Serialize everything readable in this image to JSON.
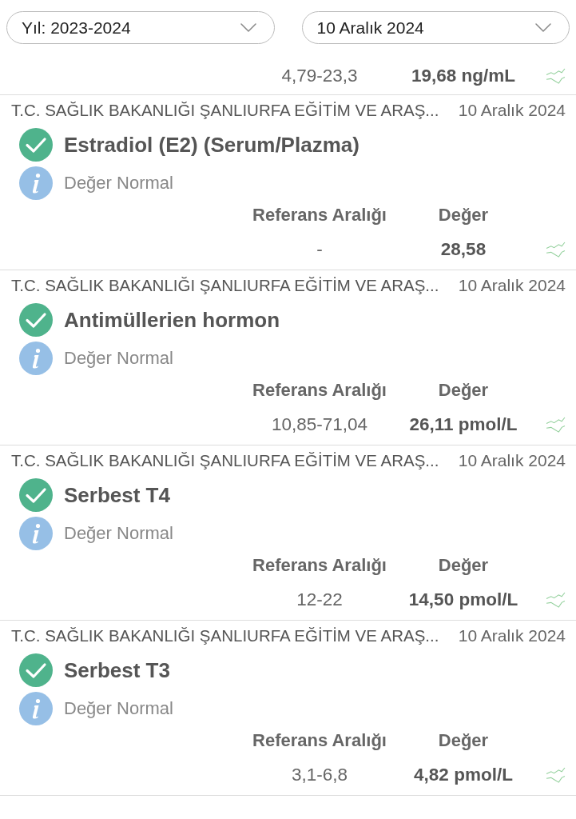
{
  "year_filter": {
    "value": "Yıl: 2023-2024"
  },
  "date_filter": {
    "value": "10 Aralık 2024"
  },
  "partial_result": {
    "reference": "4,79-23,3",
    "value": "19,68 ng/mL"
  },
  "results": [
    {
      "institution": "T.C. SAĞLIK BAKANLIĞI ŞANLIURFA EĞİTİM VE ARAŞ...",
      "date": "10 Aralık 2024",
      "test": "Estradiol (E2) (Serum/Plazma)",
      "status_text": "Değer Normal",
      "reference_label": "Referans Aralığı",
      "value_label": "Değer",
      "reference": "-",
      "value": "28,58"
    },
    {
      "institution": "T.C. SAĞLIK BAKANLIĞI ŞANLIURFA EĞİTİM VE ARAŞ...",
      "date": "10 Aralık 2024",
      "test": "Antimüllerien hormon",
      "status_text": "Değer Normal",
      "reference_label": "Referans Aralığı",
      "value_label": "Değer",
      "reference": "10,85-71,04",
      "value": "26,11 pmol/L"
    },
    {
      "institution": "T.C. SAĞLIK BAKANLIĞI ŞANLIURFA EĞİTİM VE ARAŞ...",
      "date": "10 Aralık 2024",
      "test": "Serbest T4",
      "status_text": "Değer Normal",
      "reference_label": "Referans Aralığı",
      "value_label": "Değer",
      "reference": "12-22",
      "value": "14,50 pmol/L"
    },
    {
      "institution": "T.C. SAĞLIK BAKANLIĞI ŞANLIURFA EĞİTİM VE ARAŞ...",
      "date": "10 Aralık 2024",
      "test": "Serbest T3",
      "status_text": "Değer Normal",
      "reference_label": "Referans Aralığı",
      "value_label": "Değer",
      "reference": "3,1-6,8",
      "value": "4,82 pmol/L"
    }
  ]
}
